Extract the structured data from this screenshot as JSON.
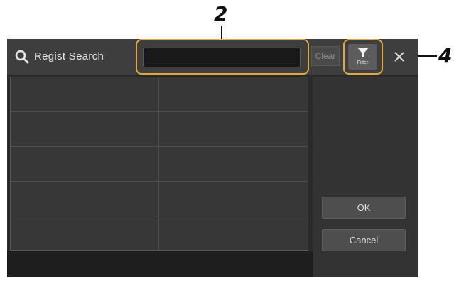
{
  "callouts": {
    "search": "2",
    "filter": "4"
  },
  "titlebar": {
    "title": "Regist Search",
    "search_icon": "search-icon"
  },
  "search": {
    "value": "",
    "placeholder": ""
  },
  "clear_button": {
    "label": "Clear"
  },
  "filter_button": {
    "label": "Filter",
    "icon": "filter-icon"
  },
  "close_button": {
    "icon": "close-icon"
  },
  "results": {
    "rows": 5,
    "columns": 2,
    "cells": [
      [
        "",
        ""
      ],
      [
        "",
        ""
      ],
      [
        "",
        ""
      ],
      [
        "",
        ""
      ],
      [
        "",
        ""
      ]
    ]
  },
  "panel": {
    "ok_label": "OK",
    "cancel_label": "Cancel"
  },
  "colors": {
    "highlight": "#e0a743",
    "window_bg": "#2a2a2a",
    "titlebar_bg": "#3e3e3e"
  }
}
